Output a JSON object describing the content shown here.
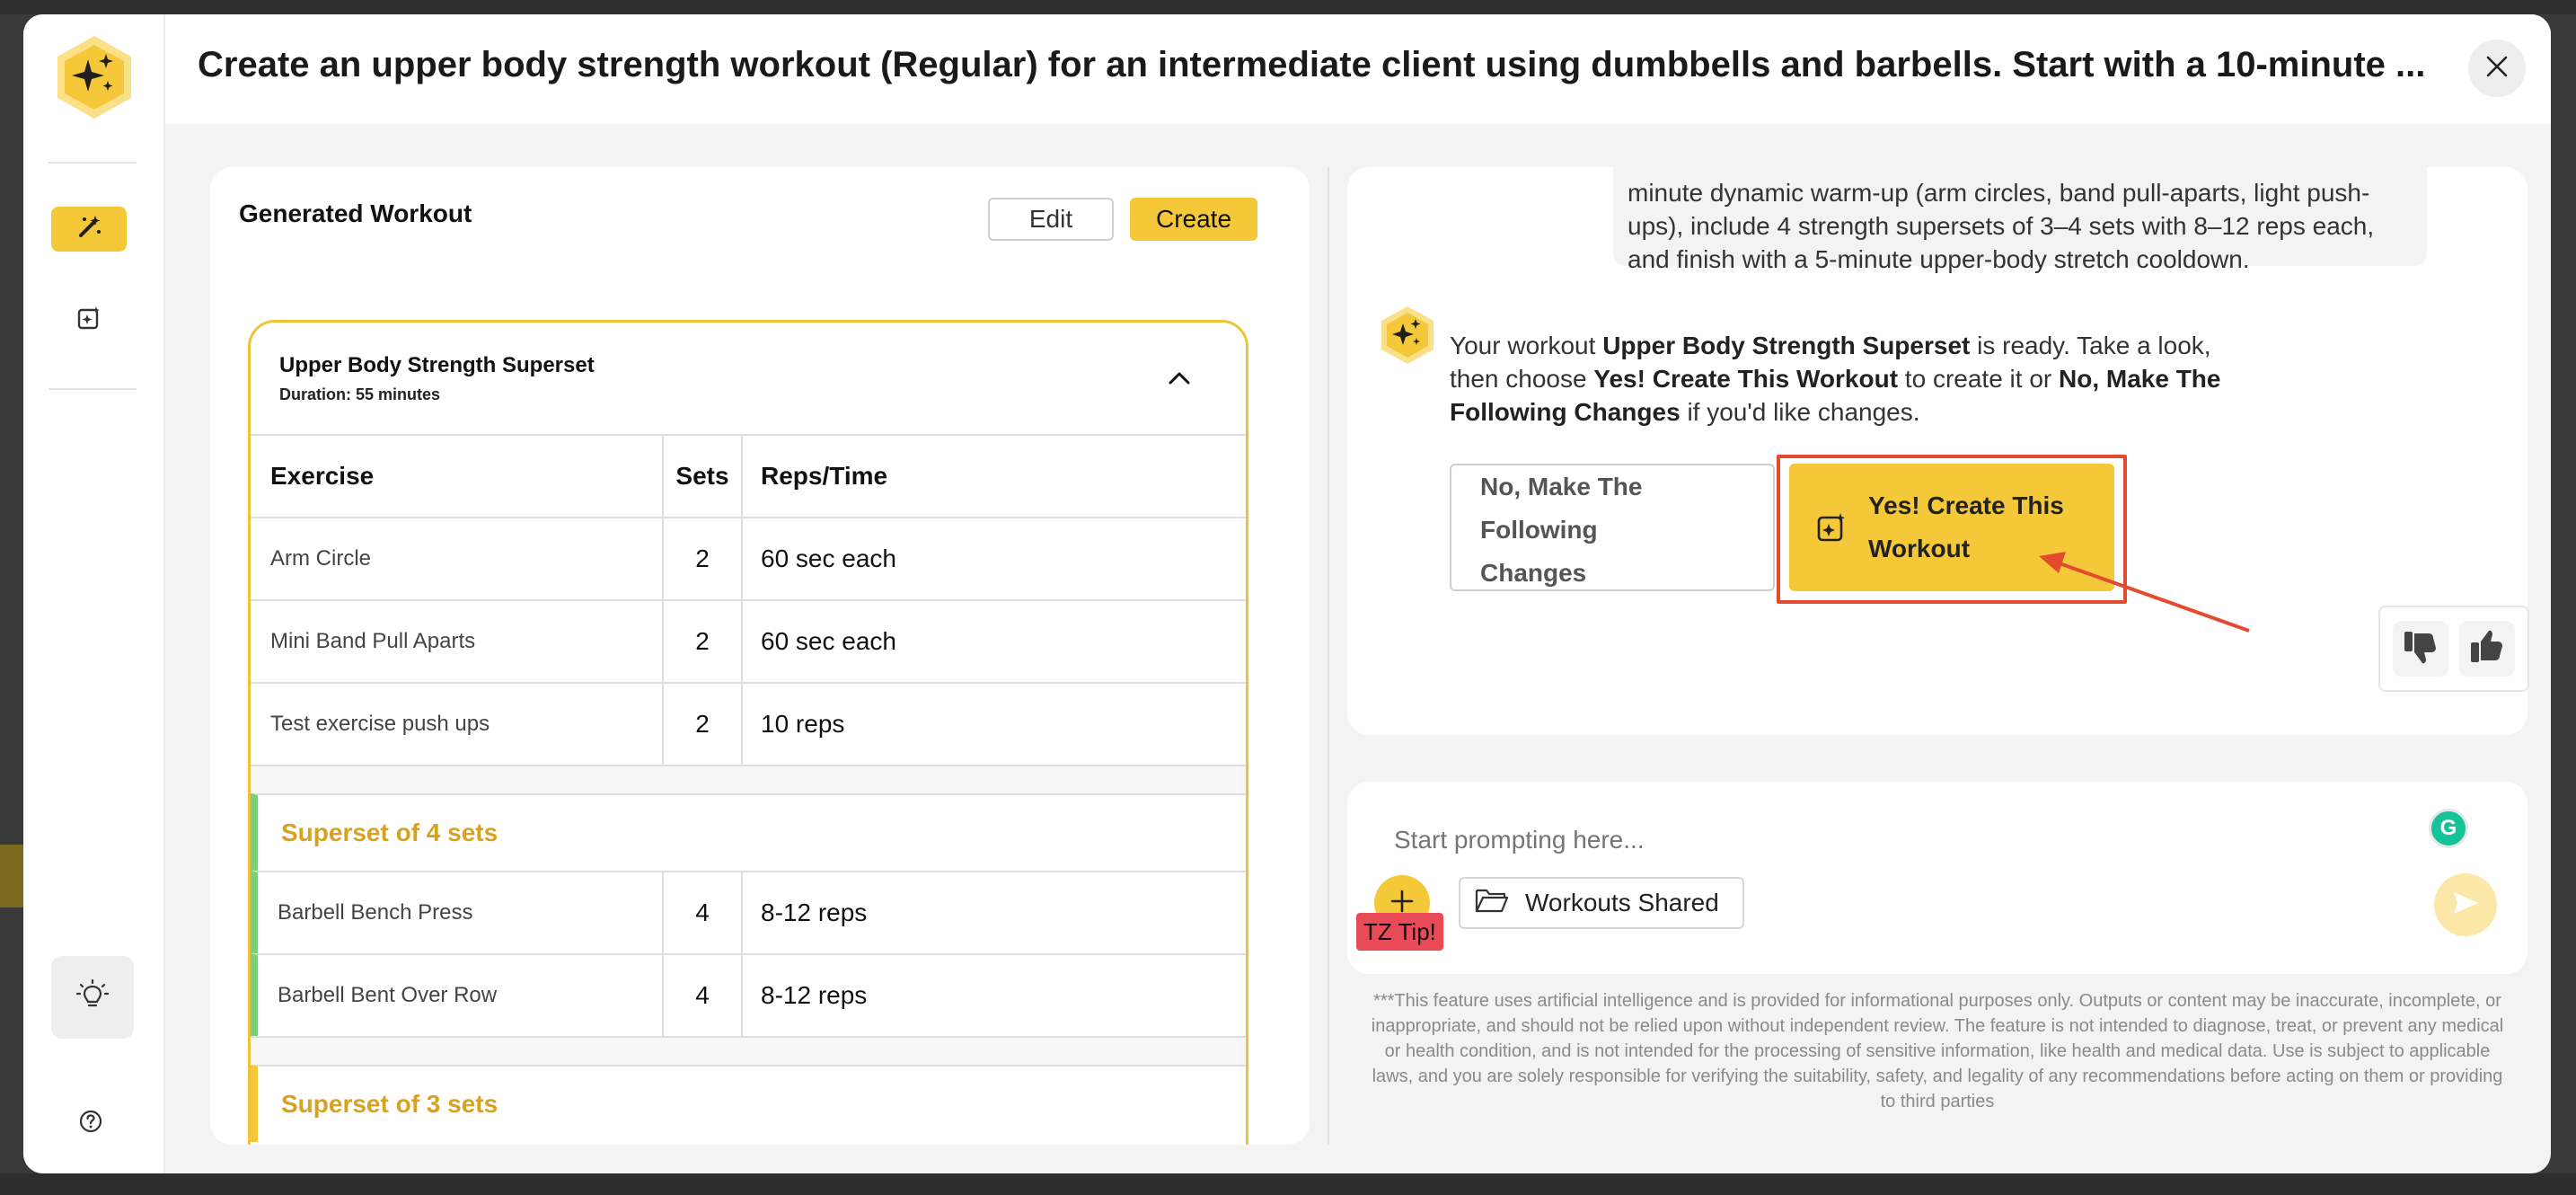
{
  "header": {
    "title": "Create an upper body strength workout (Regular) for an intermediate client using dumbbells and barbells. Start with a 10-minute ..."
  },
  "rail": {
    "icons": [
      "sparkle-logo-icon",
      "magic-wand-icon",
      "ai-sparkle-icon",
      "lightbulb-icon",
      "help-icon"
    ]
  },
  "workout_card": {
    "title": "Generated Workout",
    "edit_label": "Edit",
    "create_label": "Create",
    "workout_name": "Upper Body Strength Superset",
    "duration": "Duration: 55 minutes",
    "columns": [
      "Exercise",
      "Sets",
      "Reps/Time"
    ],
    "warmup_rows": [
      {
        "exercise": "Arm Circle",
        "sets": "2",
        "reps": "60 sec each"
      },
      {
        "exercise": "Mini Band Pull Aparts",
        "sets": "2",
        "reps": "60 sec each"
      },
      {
        "exercise": "Test exercise push ups",
        "sets": "2",
        "reps": "10 reps"
      }
    ],
    "superset1": {
      "title": "Superset of 4 sets",
      "rows": [
        {
          "exercise": "Barbell Bench Press",
          "sets": "4",
          "reps": "8-12 reps"
        },
        {
          "exercise": "Barbell Bent Over Row",
          "sets": "4",
          "reps": "8-12 reps"
        }
      ]
    },
    "superset2": {
      "title": "Superset of 3 sets"
    }
  },
  "chat": {
    "user_message": "minute dynamic warm-up (arm circles, band pull-aparts, light push-ups), include 4 strength supersets of 3–4 sets with 8–12 reps each, and finish with a 5-minute upper-body stretch cooldown.",
    "bot_prefix": "Your workout ",
    "bot_workout_name": "Upper Body Strength Superset",
    "bot_middle": " is ready. Take a look, then choose ",
    "bot_yes_phrase": "Yes! Create This Workout",
    "bot_middle2": " to create it or ",
    "bot_no_phrase": "No, Make The Following Changes",
    "bot_suffix": " if you'd like changes.",
    "no_button": "No, Make The Following Changes",
    "yes_button": "Yes! Create This Workout"
  },
  "prompt": {
    "placeholder": "Start prompting here...",
    "tip_label": "TZ Tip!",
    "folder_label": "Workouts Shared",
    "grammarly_label": "G"
  },
  "disclaimer": "***This feature uses artificial intelligence and is provided for informational purposes only. Outputs or content may be inaccurate, incomplete, or inappropriate, and should not be relied upon without independent review. The feature is not intended to diagnose, treat, or prevent any medical or health condition, and is not intended for the processing of sensitive information, like health and medical data. Use is subject to applicable laws, and you are solely responsible for verifying the suitability, safety, and legality of any recommendations before acting on them or providing to third parties",
  "colors": {
    "accent": "#f5c83a",
    "superset_text": "#d9a21e",
    "superset_bar": "#7ccf7a",
    "highlight": "#e24b2e"
  }
}
